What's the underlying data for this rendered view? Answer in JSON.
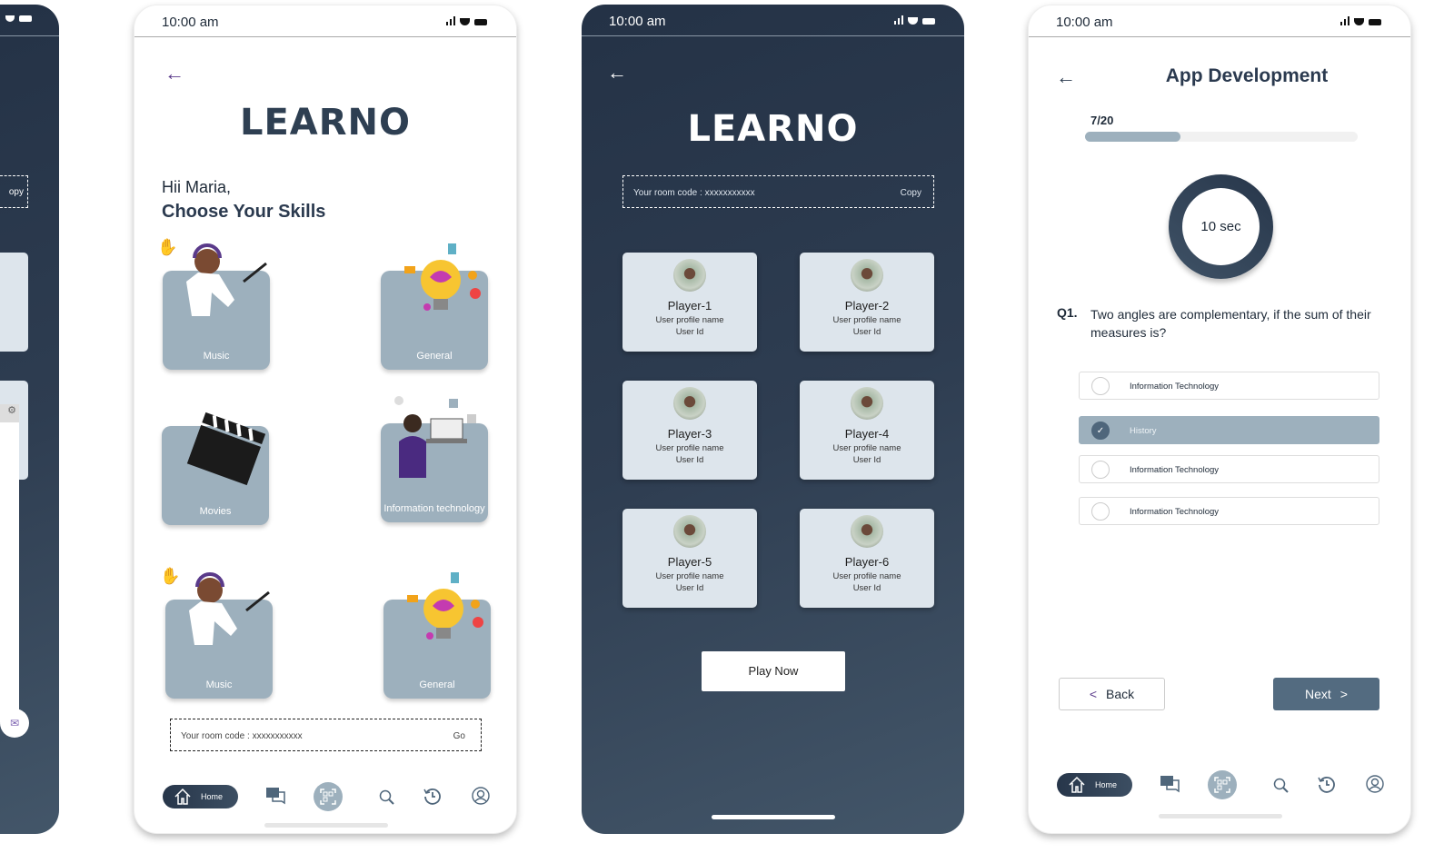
{
  "status_bar": {
    "time": "10:00 am"
  },
  "brand": {
    "logo": "LEARNO",
    "accent": "#2e3f52",
    "card_color": "#9db0bd",
    "selected_color": "#9db0bd",
    "primary_button": "#536b80"
  },
  "screen0": {
    "copy_fragment": "opy"
  },
  "skills_screen": {
    "greeting": "Hii Maria,",
    "heading": "Choose Your Skills",
    "categories": [
      {
        "label": "Music",
        "art": "girl-with-headphones"
      },
      {
        "label": "General",
        "art": "lightbulb-brain"
      },
      {
        "label": "Movies",
        "art": "clapperboard"
      },
      {
        "label": "Information technology",
        "art": "woman-with-laptop"
      },
      {
        "label": "Music",
        "art": "girl-with-headphones"
      },
      {
        "label": "General",
        "art": "lightbulb-brain"
      }
    ],
    "room_code": {
      "label": "Your room code  : xxxxxxxxxxx",
      "action": "Go"
    }
  },
  "lobby_screen": {
    "room_code": {
      "label": "Your room code  : xxxxxxxxxxx",
      "action": "Copy"
    },
    "players": [
      {
        "name": "Player-1",
        "profile": "User profile name",
        "id": "User Id"
      },
      {
        "name": "Player-2",
        "profile": "User profile name",
        "id": "User Id"
      },
      {
        "name": "Player-3",
        "profile": "User profile name",
        "id": "User Id"
      },
      {
        "name": "Player-4",
        "profile": "User profile name",
        "id": "User Id"
      },
      {
        "name": "Player-5",
        "profile": "User profile name",
        "id": "User Id"
      },
      {
        "name": "Player-6",
        "profile": "User profile name",
        "id": "User Id"
      }
    ],
    "play_button": "Play Now"
  },
  "quiz_screen": {
    "title": "App Development",
    "progress": {
      "label": "7/20",
      "current": 7,
      "total": 20
    },
    "timer": "10 sec",
    "question_number": "Q1.",
    "question": "Two angles are complementary, if the sum of their measures is?",
    "options": [
      {
        "label": "Information Technology",
        "selected": false
      },
      {
        "label": "History",
        "selected": true
      },
      {
        "label": "Information Technology",
        "selected": false
      },
      {
        "label": "Information Technology",
        "selected": false
      }
    ],
    "back_button": "Back",
    "next_button": "Next"
  },
  "nav": {
    "home_label": "Home",
    "items": [
      "home-icon",
      "chat-icon",
      "qr-scan-icon",
      "search-icon",
      "history-icon",
      "profile-icon"
    ]
  }
}
